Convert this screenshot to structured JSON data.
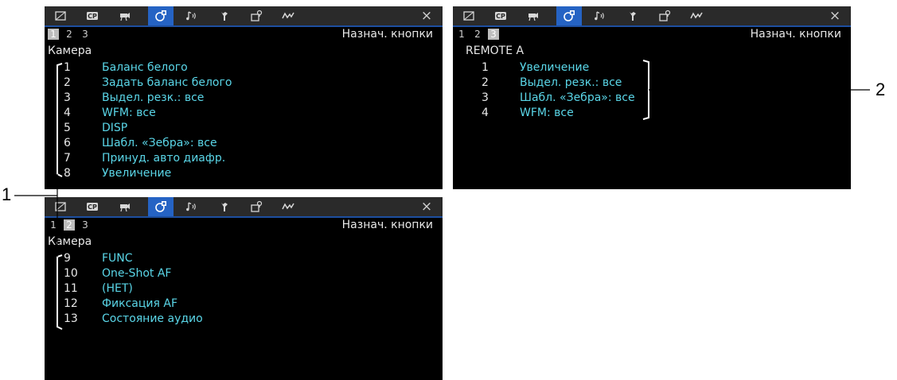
{
  "tabs": [
    {
      "icon": "frame-icon"
    },
    {
      "icon": "cp-icon",
      "label": "CP"
    },
    {
      "icon": "camera-icon"
    },
    {
      "icon": "custom-settings-icon"
    },
    {
      "icon": "audio-icon"
    },
    {
      "icon": "wrench-icon"
    },
    {
      "icon": "assignable-icon"
    },
    {
      "icon": "waveform-icon"
    }
  ],
  "close_label": "×",
  "accent_color": "#2563c4",
  "value_color": "#5ad6e8",
  "page_title": "Назнач. кнопки",
  "pages": [
    "1",
    "2",
    "3"
  ],
  "screen_camera_p1": {
    "selected_page": "1",
    "heading": "Камера",
    "items": [
      {
        "num": "1",
        "value": "Баланс белого"
      },
      {
        "num": "2",
        "value": "Задать баланс белого"
      },
      {
        "num": "3",
        "value": "Выдел. резк.: все"
      },
      {
        "num": "4",
        "value": "WFM: все"
      },
      {
        "num": "5",
        "value": "DISP"
      },
      {
        "num": "6",
        "value": "Шабл. «Зебра»: все"
      },
      {
        "num": "7",
        "value": "Принуд. авто диафр."
      },
      {
        "num": "8",
        "value": "Увеличение"
      }
    ]
  },
  "screen_camera_p2": {
    "selected_page": "2",
    "heading": "Камера",
    "items": [
      {
        "num": "9",
        "value": "FUNC"
      },
      {
        "num": "10",
        "value": "One-Shot AF"
      },
      {
        "num": "11",
        "value": "(НЕТ)"
      },
      {
        "num": "12",
        "value": "Фиксация AF"
      },
      {
        "num": "13",
        "value": "Состояние аудио"
      }
    ]
  },
  "screen_remote_p3": {
    "selected_page": "3",
    "heading": "REMOTE A",
    "items": [
      {
        "num": "1",
        "value": "Увеличение"
      },
      {
        "num": "2",
        "value": "Выдел. резк.: все"
      },
      {
        "num": "3",
        "value": "Шабл. «Зебра»: все"
      },
      {
        "num": "4",
        "value": "WFM: все"
      }
    ]
  },
  "callouts": {
    "one": "1",
    "two": "2"
  }
}
